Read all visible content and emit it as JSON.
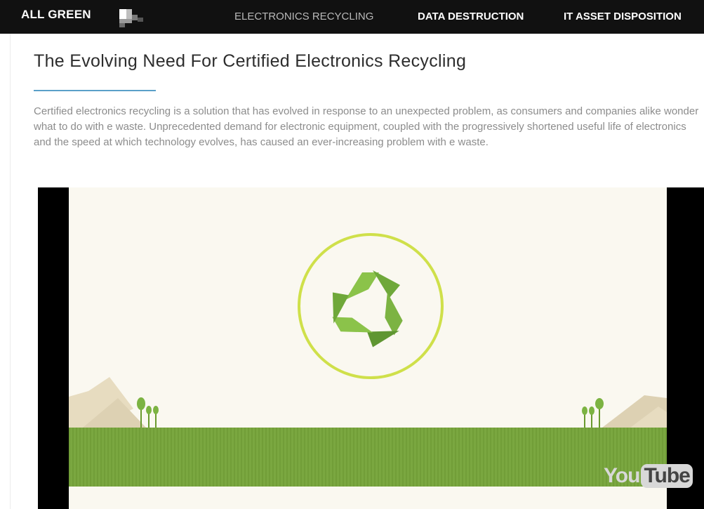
{
  "header": {
    "logo_text": "ALL GREEN",
    "nav": [
      {
        "label": "ELECTRONICS RECYCLING",
        "active": true
      },
      {
        "label": "DATA DESTRUCTION",
        "active": false
      },
      {
        "label": "IT ASSET DISPOSITION",
        "active": false
      }
    ]
  },
  "article": {
    "title": "The Evolving Need For Certified Electronics Recycling",
    "intro": "Certified electronics recycling is a solution that has evolved in response to an unexpected problem, as consumers and companies alike wonder what to do with e waste. Unprecedented demand for electronic equipment, coupled with the progressively shortened useful life of electronics and the speed at which technology evolves, has caused an ever-increasing problem with e waste."
  },
  "video": {
    "icon": "recycle-icon",
    "watermark_left": "You",
    "watermark_right": "Tube"
  },
  "colors": {
    "accent_rule": "#5aa0c8",
    "grass": "#76a43a",
    "recycle_green": "#7cb342",
    "circle": "#cfe04a"
  }
}
